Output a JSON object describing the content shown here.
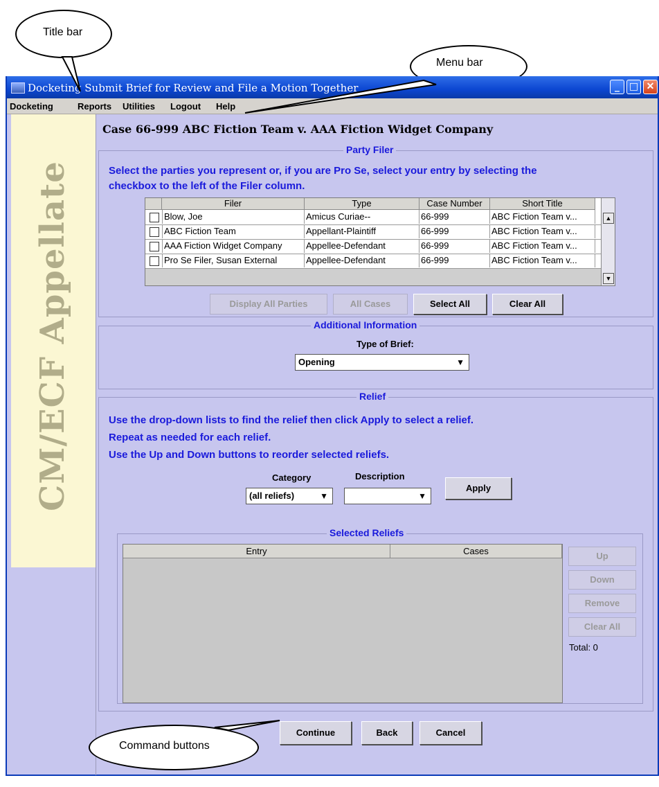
{
  "window": {
    "title": "Docketing Submit Brief for Review and File a Motion Together",
    "controls": {
      "minimize_icon": "minimize-icon",
      "maximize_icon": "maximize-icon",
      "close_icon": "close-icon"
    }
  },
  "menu": [
    "Docketing",
    "Reports",
    "Utilities",
    "Logout",
    "Help"
  ],
  "sidebar": {
    "brand": "CM/ECF Appellate"
  },
  "case_title": "Case 66-999 ABC Fiction Team v. AAA Fiction Widget Company",
  "party_filer": {
    "legend": "Party Filer",
    "instructions": [
      "Select the parties you represent or, if you are Pro Se, select your entry by selecting the",
      "checkbox to the left of the Filer column."
    ],
    "columns": [
      "Filer",
      "Type",
      "Case Number",
      "Short Title"
    ],
    "rows": [
      [
        "Blow, Joe",
        "Amicus Curiae--",
        "66-999",
        "ABC Fiction Team v..."
      ],
      [
        "ABC Fiction Team",
        "Appellant-Plaintiff",
        "66-999",
        "ABC Fiction Team v..."
      ],
      [
        "AAA Fiction Widget Company",
        "Appellee-Defendant",
        "66-999",
        "ABC Fiction Team v..."
      ],
      [
        "Pro Se Filer, Susan External",
        "Appellee-Defendant",
        "66-999",
        "ABC Fiction Team v..."
      ]
    ],
    "buttons": {
      "display_all": "Display All Parties",
      "all_cases": "All Cases",
      "select_all": "Select All",
      "clear_all": "Clear All"
    }
  },
  "additional_info": {
    "legend": "Additional Information",
    "type_label": "Type of Brief:",
    "type_value": "Opening"
  },
  "relief": {
    "legend": "Relief",
    "instructions": [
      "Use the drop-down lists to find the relief then click Apply to select a relief.",
      "Repeat as needed for each relief.",
      "Use the Up and Down buttons to reorder selected reliefs."
    ],
    "category_label": "Category",
    "category_value": "(all reliefs)",
    "description_label": "Description",
    "description_value": "",
    "apply": "Apply",
    "selected": {
      "legend": "Selected Reliefs",
      "columns": [
        "Entry",
        "Cases"
      ],
      "buttons": {
        "up": "Up",
        "down": "Down",
        "remove": "Remove",
        "clear_all": "Clear All"
      },
      "total": "Total: 0"
    }
  },
  "commands": {
    "continue": "Continue",
    "back": "Back",
    "cancel": "Cancel"
  },
  "callouts": {
    "title_bar": "Title bar",
    "menu_bar": "Menu bar",
    "command_buttons": "Command buttons"
  }
}
